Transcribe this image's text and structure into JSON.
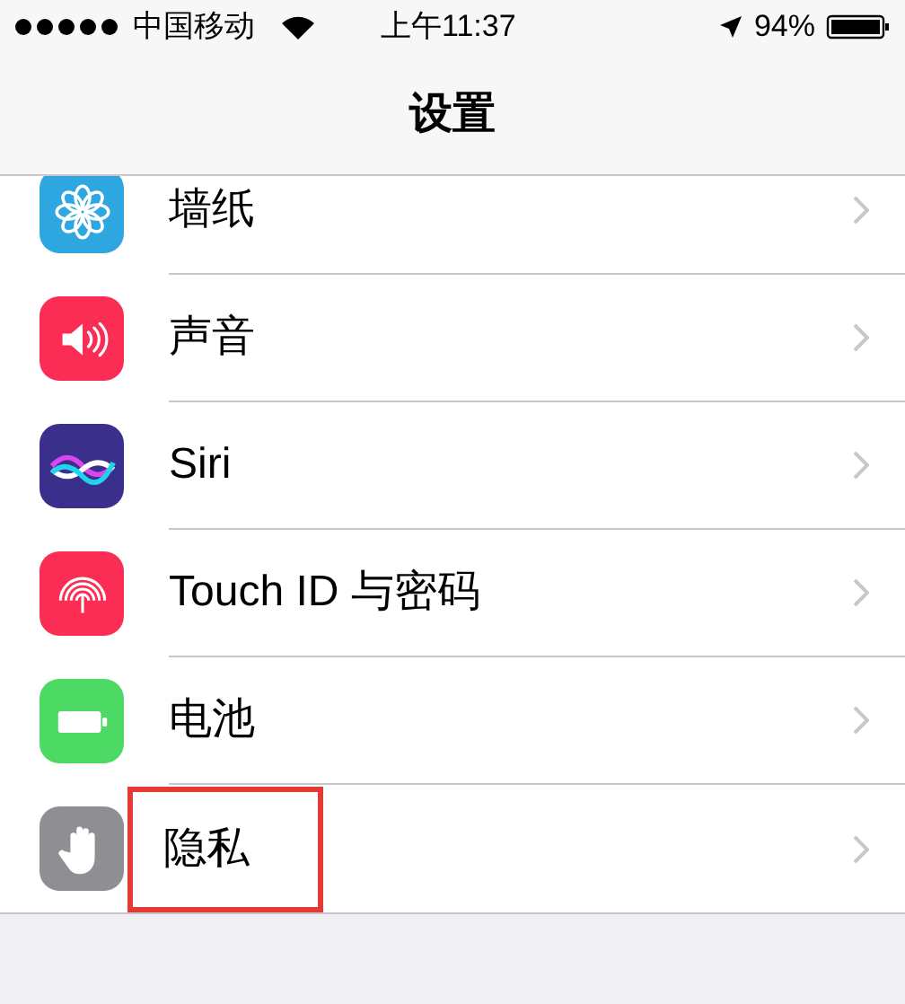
{
  "status_bar": {
    "carrier": "中国移动",
    "time": "上午11:37",
    "battery": "94%"
  },
  "nav_bar": {
    "title": "设置"
  },
  "rows": [
    {
      "kind": "wallpaper",
      "label": "墙纸",
      "color": "#2ea7e0",
      "highlighted": false
    },
    {
      "kind": "sound",
      "label": "声音",
      "color": "#fc2d55",
      "highlighted": false
    },
    {
      "kind": "siri",
      "label": "Siri",
      "color": "#3a2f8a",
      "highlighted": false
    },
    {
      "kind": "touchid",
      "label": "Touch ID 与密码",
      "color": "#fc2d55",
      "highlighted": false
    },
    {
      "kind": "battery",
      "label": "电池",
      "color": "#4cd964",
      "highlighted": false
    },
    {
      "kind": "privacy",
      "label": "隐私",
      "color": "#8e8e93",
      "highlighted": true
    }
  ]
}
